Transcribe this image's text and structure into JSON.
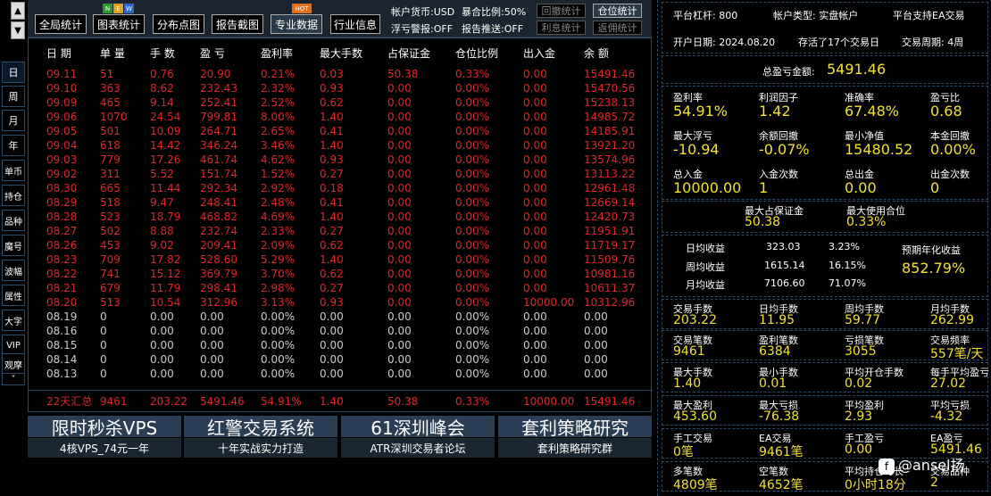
{
  "nav": {
    "up": "▲",
    "down": "▼",
    "tabs": [
      "日",
      "周",
      "月",
      "年",
      "单币",
      "持仓",
      "品种",
      "魔号",
      "波幅",
      "属性",
      "大字",
      "VIP",
      "观摩"
    ],
    "more": "˅"
  },
  "toolbar": {
    "buttons": [
      "全局统计",
      "图表统计",
      "分布点图",
      "报告截图",
      "专业数据",
      "行业信息"
    ],
    "active_button": "专业数据",
    "badges": {
      "n": "N",
      "e": "E",
      "w": "W",
      "hot": "HOT"
    },
    "account_currency": "帐户货币:USD",
    "margin_ratio": "暴合比例:50%",
    "float_warning": "浮亏警报:OFF",
    "report_push": "报告推送:OFF",
    "small_buttons": [
      "回撤统计",
      "仓位统计",
      "利息统计",
      "返佣统计"
    ],
    "small_active": "仓位统计"
  },
  "table": {
    "headers": [
      "日 期",
      "单 量",
      "手 数",
      "盈 亏",
      "盈利率",
      "最大手数",
      "占保证金",
      "仓位比例",
      "出入金",
      "余 额"
    ],
    "rows": [
      [
        "09.11",
        "51",
        "0.76",
        "20.90",
        "0.21%",
        "0.03",
        "50.38",
        "0.33%",
        "0.00",
        "15491.46"
      ],
      [
        "09.10",
        "363",
        "8.62",
        "232.43",
        "2.32%",
        "0.93",
        "0.00",
        "0.00%",
        "0.00",
        "15470.56"
      ],
      [
        "09.09",
        "465",
        "9.14",
        "252.41",
        "2.52%",
        "0.62",
        "0.00",
        "0.00%",
        "0.00",
        "15238.13"
      ],
      [
        "09.06",
        "1070",
        "24.54",
        "799.81",
        "8.00%",
        "1.40",
        "0.00",
        "0.00%",
        "0.00",
        "14985.72"
      ],
      [
        "09.05",
        "501",
        "10.09",
        "264.71",
        "2.65%",
        "0.41",
        "0.00",
        "0.00%",
        "0.00",
        "14185.91"
      ],
      [
        "09.04",
        "618",
        "14.42",
        "346.24",
        "3.46%",
        "1.40",
        "0.00",
        "0.00%",
        "0.00",
        "13921.20"
      ],
      [
        "09.03",
        "779",
        "17.26",
        "461.74",
        "4.62%",
        "0.93",
        "0.00",
        "0.00%",
        "0.00",
        "13574.96"
      ],
      [
        "09.02",
        "311",
        "5.52",
        "151.74",
        "1.52%",
        "0.27",
        "0.00",
        "0.00%",
        "0.00",
        "13113.22"
      ],
      [
        "08.30",
        "665",
        "11.44",
        "292.34",
        "2.92%",
        "0.18",
        "0.00",
        "0.00%",
        "0.00",
        "12961.48"
      ],
      [
        "08.29",
        "518",
        "9.47",
        "248.41",
        "2.48%",
        "0.41",
        "0.00",
        "0.00%",
        "0.00",
        "12669.14"
      ],
      [
        "08.28",
        "523",
        "18.79",
        "468.82",
        "4.69%",
        "1.40",
        "0.00",
        "0.00%",
        "0.00",
        "12420.73"
      ],
      [
        "08.27",
        "502",
        "8.88",
        "232.74",
        "2.33%",
        "0.27",
        "0.00",
        "0.00%",
        "0.00",
        "11951.91"
      ],
      [
        "08.26",
        "453",
        "9.02",
        "209.41",
        "2.09%",
        "0.62",
        "0.00",
        "0.00%",
        "0.00",
        "11719.17"
      ],
      [
        "08.23",
        "709",
        "17.82",
        "528.60",
        "5.29%",
        "1.40",
        "0.00",
        "0.00%",
        "0.00",
        "11509.76"
      ],
      [
        "08.22",
        "741",
        "15.12",
        "369.79",
        "3.70%",
        "0.62",
        "0.00",
        "0.00%",
        "0.00",
        "10981.16"
      ],
      [
        "08.21",
        "679",
        "11.79",
        "298.41",
        "2.98%",
        "0.27",
        "0.00",
        "0.00%",
        "0.00",
        "10611.37"
      ],
      [
        "08.20",
        "513",
        "10.54",
        "312.96",
        "3.13%",
        "0.93",
        "0.00",
        "0.00%",
        "10000.00",
        "10312.96"
      ],
      [
        "08.19",
        "0",
        "0.00",
        "0.00",
        "0.00%",
        "0.00",
        "0.00",
        "0.00%",
        "0.00",
        "0.00"
      ],
      [
        "08.16",
        "0",
        "0.00",
        "0.00",
        "0.00%",
        "0.00",
        "0.00",
        "0.00%",
        "0.00",
        "0.00"
      ],
      [
        "08.15",
        "0",
        "0.00",
        "0.00",
        "0.00%",
        "0.00",
        "0.00",
        "0.00%",
        "0.00",
        "0.00"
      ],
      [
        "08.14",
        "0",
        "0.00",
        "0.00",
        "0.00%",
        "0.00",
        "0.00",
        "0.00%",
        "0.00",
        "0.00"
      ],
      [
        "08.13",
        "0",
        "0.00",
        "0.00",
        "0.00%",
        "0.00",
        "0.00",
        "0.00%",
        "0.00",
        "0.00"
      ]
    ],
    "active_rows": 17,
    "summary": [
      "22天汇总",
      "9461",
      "203.22",
      "5491.46",
      "54.91%",
      "1.40",
      "50.38",
      "0.33%",
      "10000.00",
      "15491.46"
    ]
  },
  "banners": [
    {
      "title": "限时秒杀VPS",
      "sub": "4核VPS_74元一年"
    },
    {
      "title": "红警交易系统",
      "sub": "十年实战实力打造"
    },
    {
      "title": "61深圳峰会",
      "sub": "ATR深圳交易者论坛"
    },
    {
      "title": "套利策略研究",
      "sub": "套利策略研究群"
    }
  ],
  "panel": {
    "leverage": "平台杠杆:  800",
    "account_type": "帐户类型:  实盘帐户",
    "ea_support": "平台支持EA交易",
    "open_date": "开户日期:  2024.08.20",
    "trade_days": "存活了17个交易日",
    "cycle": "交易周期:  4周",
    "total_pl_label": "总盈亏金额:",
    "total_pl": "5491.46",
    "grid1": [
      {
        "label": "盈利率",
        "value": "54.91%"
      },
      {
        "label": "利润因子",
        "value": "1.42"
      },
      {
        "label": "准确率",
        "value": "67.48%"
      },
      {
        "label": "盈亏比",
        "value": "0.68"
      },
      {
        "label": "最大浮亏",
        "value": "-10.94"
      },
      {
        "label": "余额回撤",
        "value": "-0.07%"
      },
      {
        "label": "最小净值",
        "value": "15480.52"
      },
      {
        "label": "本金回撤",
        "value": "0.00%"
      },
      {
        "label": "总入金",
        "value": "10000.00"
      },
      {
        "label": "入金次数",
        "value": "1"
      },
      {
        "label": "总出金",
        "value": "0.00"
      },
      {
        "label": "出金次数",
        "value": "0"
      }
    ],
    "max_margin_label": "最大占保证金",
    "max_margin": "50.38",
    "max_position_label": "最大使用合位",
    "max_position": "0.33%",
    "daily_label": "日均收益",
    "daily_value": "323.03",
    "daily_pct": "3.23%",
    "weekly_label": "周均收益",
    "weekly_value": "1615.14",
    "weekly_pct": "16.15%",
    "monthly_label": "月均收益",
    "monthly_value": "7106.60",
    "monthly_pct": "71.07%",
    "annual_label": "预期年化收益",
    "annual_value": "852.79%",
    "grid2": [
      {
        "label": "交易手数",
        "value": "203.22"
      },
      {
        "label": "日均手数",
        "value": "11.95"
      },
      {
        "label": "周均手数",
        "value": "59.77"
      },
      {
        "label": "月均手数",
        "value": "262.99"
      },
      {
        "label": "交易笔数",
        "value": "9461"
      },
      {
        "label": "盈利笔数",
        "value": "6384"
      },
      {
        "label": "亏损笔数",
        "value": "3055"
      },
      {
        "label": "交易频率",
        "value": "557笔/天"
      },
      {
        "label": "最大手数",
        "value": "1.40"
      },
      {
        "label": "最小手数",
        "value": "0.01"
      },
      {
        "label": "平均开仓手数",
        "value": "0.02"
      },
      {
        "label": "每手平均盈亏",
        "value": "27.02"
      },
      {
        "label": "最大盈利",
        "value": "453.60"
      },
      {
        "label": "最大亏损",
        "value": "-76.38"
      },
      {
        "label": "平均盈利",
        "value": "2.93"
      },
      {
        "label": "平均亏损",
        "value": "-4.32"
      },
      {
        "label": "手工交易",
        "value": "0笔"
      },
      {
        "label": "EA交易",
        "value": "9461笔"
      },
      {
        "label": "手工盈亏",
        "value": "0.00"
      },
      {
        "label": "EA盈亏",
        "value": "5491.46"
      },
      {
        "label": "多笔数",
        "value": "4809笔"
      },
      {
        "label": "空笔数",
        "value": "4652笔"
      },
      {
        "label": "平均持仓时长",
        "value": "0小时18分"
      },
      {
        "label": "交易品种",
        "value": "2"
      }
    ]
  },
  "watermark": {
    "logo": "f",
    "text": "@ansel扬"
  },
  "colors": {
    "red": "#e0262a",
    "yellow": "#f2e22a",
    "panel_border": "#2a4a6a",
    "banner": "#2a3e55"
  }
}
